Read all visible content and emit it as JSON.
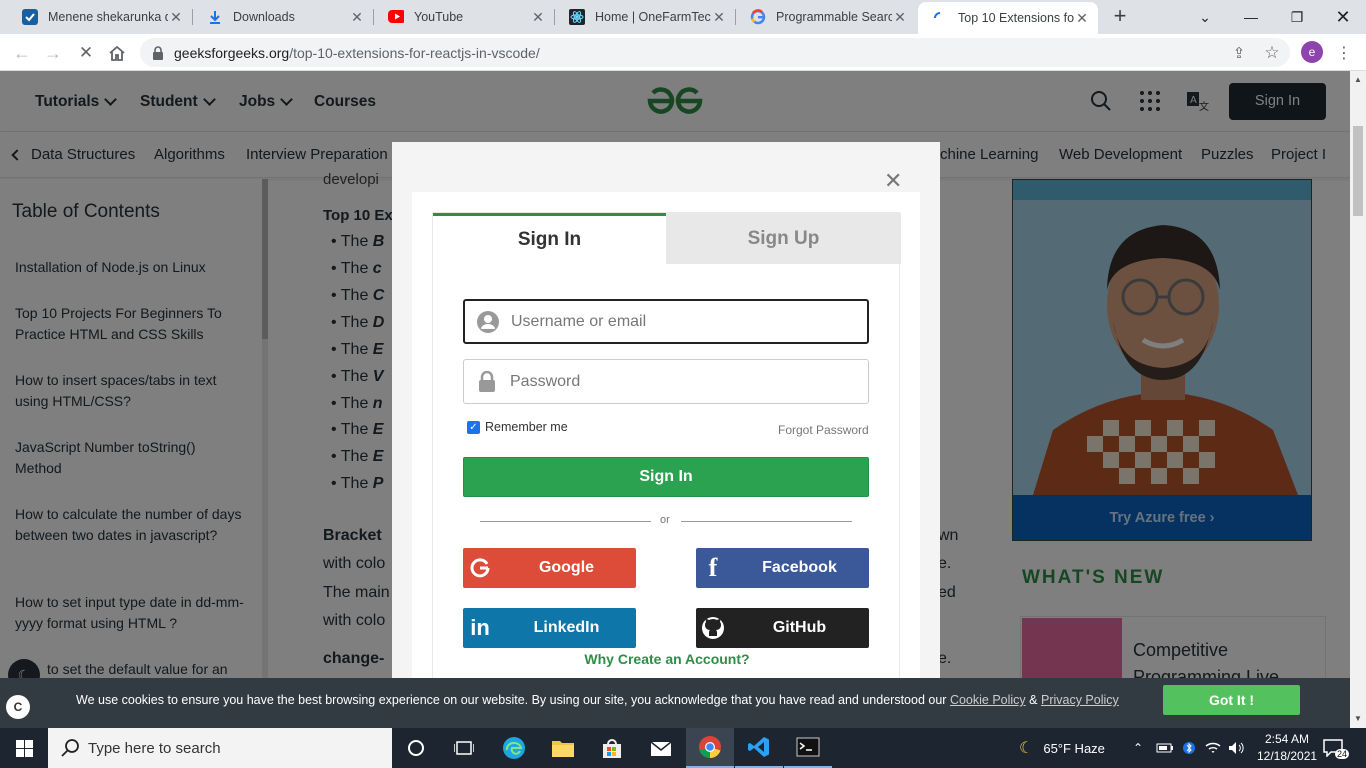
{
  "browser": {
    "tabs": [
      {
        "title": "Menene shekarunka d",
        "icon": "check-icon"
      },
      {
        "title": "Downloads",
        "icon": "download-icon"
      },
      {
        "title": "YouTube",
        "icon": "youtube-icon"
      },
      {
        "title": "Home | OneFarmTech",
        "icon": "react-icon"
      },
      {
        "title": "Programmable Search",
        "icon": "google-icon"
      },
      {
        "title": "Top 10 Extensions for",
        "icon": "loading-icon",
        "active": true
      }
    ],
    "url_host": "geeksforgeeks.org",
    "url_path": "/top-10-extensions-for-reactjs-in-vscode/",
    "profile_initial": "e"
  },
  "header": {
    "nav": [
      "Tutorials",
      "Student",
      "Jobs",
      "Courses"
    ],
    "signin": "Sign In"
  },
  "subnav": [
    "Data Structures",
    "Algorithms",
    "Interview Preparation",
    "chine Learning",
    "Web Development",
    "Puzzles",
    "Project I"
  ],
  "toc": {
    "title": "Table of Contents",
    "links": [
      "Installation of Node.js on Linux",
      "Top 10 Projects For Beginners To Practice HTML and CSS Skills",
      "How to insert spaces/tabs in text using HTML/CSS?",
      "JavaScript Number toString() Method",
      "How to calculate the number of days between two dates in javascript?",
      "How to set input type date in dd-mm-yyyy format using HTML ?",
      "to set the default value for an"
    ]
  },
  "article": {
    "faded": "developi",
    "heading": "Top 10 Ex",
    "list_items": [
      {
        "pre": "The ",
        "em": "B"
      },
      {
        "pre": "The ",
        "em": "c"
      },
      {
        "pre": "The ",
        "em": "C"
      },
      {
        "pre": "The ",
        "em": "D"
      },
      {
        "pre": "The ",
        "em": "E"
      },
      {
        "pre": "The ",
        "em": "V"
      },
      {
        "pre": "The ",
        "em": "n"
      },
      {
        "pre": "The ",
        "em": "E"
      },
      {
        "pre": "The ",
        "em": "E"
      },
      {
        "pre": "The ",
        "em": "P"
      }
    ],
    "bracket": "Bracket",
    "p1": "with colo",
    "p2": "The main",
    "p3": "with colo",
    "change": "change-",
    "right_frag": [
      "wn",
      "e.",
      "ed",
      "e."
    ]
  },
  "sidebar": {
    "ad_cta": "Try Azure free",
    "whats_new": "WHAT'S NEW",
    "card_title": "Competitive Programming Live"
  },
  "modal": {
    "tab_signin": "Sign In",
    "tab_signup": "Sign Up",
    "username_placeholder": "Username or email",
    "password_placeholder": "Password",
    "remember": "Remember me",
    "forgot": "Forgot Password",
    "signin_button": "Sign In",
    "or": "or",
    "google": "Google",
    "facebook": "Facebook",
    "linkedin": "LinkedIn",
    "github": "GitHub",
    "why": "Why Create an Account?"
  },
  "cookie": {
    "text": "We use cookies to ensure you have the best browsing experience on our website. By using our site, you acknowledge that you have read and understood our",
    "cookie_policy": "Cookie Policy",
    "amp": "&",
    "privacy_policy": "Privacy Policy",
    "button": "Got It !"
  },
  "taskbar": {
    "search_placeholder": "Type here to search",
    "weather": "65°F  Haze",
    "time": "2:54 AM",
    "date": "12/18/2021",
    "notifications": "24"
  },
  "colors": {
    "gfg_green": "#2f8d46",
    "signin_green": "#2ba24f",
    "google": "#dd4b39",
    "facebook": "#3b5998",
    "linkedin": "#0e76a8",
    "github": "#222222"
  }
}
